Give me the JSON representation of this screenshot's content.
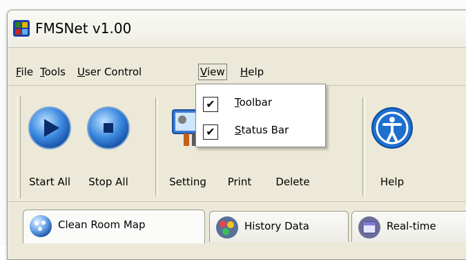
{
  "window": {
    "title": "FMSNet v1.00"
  },
  "menubar": {
    "items": [
      {
        "mnemonic": "F",
        "rest": "ile"
      },
      {
        "mnemonic": "T",
        "rest": "ools"
      },
      {
        "mnemonic": "U",
        "rest": "ser Control"
      },
      {
        "mnemonic": "V",
        "rest": "iew"
      },
      {
        "mnemonic": "H",
        "rest": "elp"
      }
    ]
  },
  "view_menu": {
    "items": [
      {
        "checked": true,
        "mnemonic": "T",
        "rest": "oolbar",
        "check_glyph": "✔"
      },
      {
        "checked": true,
        "mnemonic": "S",
        "rest": "tatus Bar",
        "check_glyph": "✔"
      }
    ]
  },
  "toolbar": {
    "buttons": [
      {
        "label": "Start All",
        "icon": "play-icon"
      },
      {
        "label": "Stop All",
        "icon": "stop-icon"
      },
      {
        "label": "Setting",
        "icon": "settings-monitor-icon"
      },
      {
        "label": "Print",
        "icon": "printer-icon"
      },
      {
        "label": "Delete",
        "icon": "delete-icon"
      },
      {
        "label": "Help",
        "icon": "accessibility-help-icon"
      }
    ]
  },
  "tabs": [
    {
      "label": "Clean Room Map",
      "icon": "map-icon",
      "active": true
    },
    {
      "label": "History Data",
      "icon": "history-data-icon",
      "active": false
    },
    {
      "label": "Real-time",
      "icon": "realtime-calendar-icon",
      "active": false
    }
  ],
  "colors": {
    "accent_blue": "#1f6fcf",
    "window_bg": "#ece9d8"
  }
}
